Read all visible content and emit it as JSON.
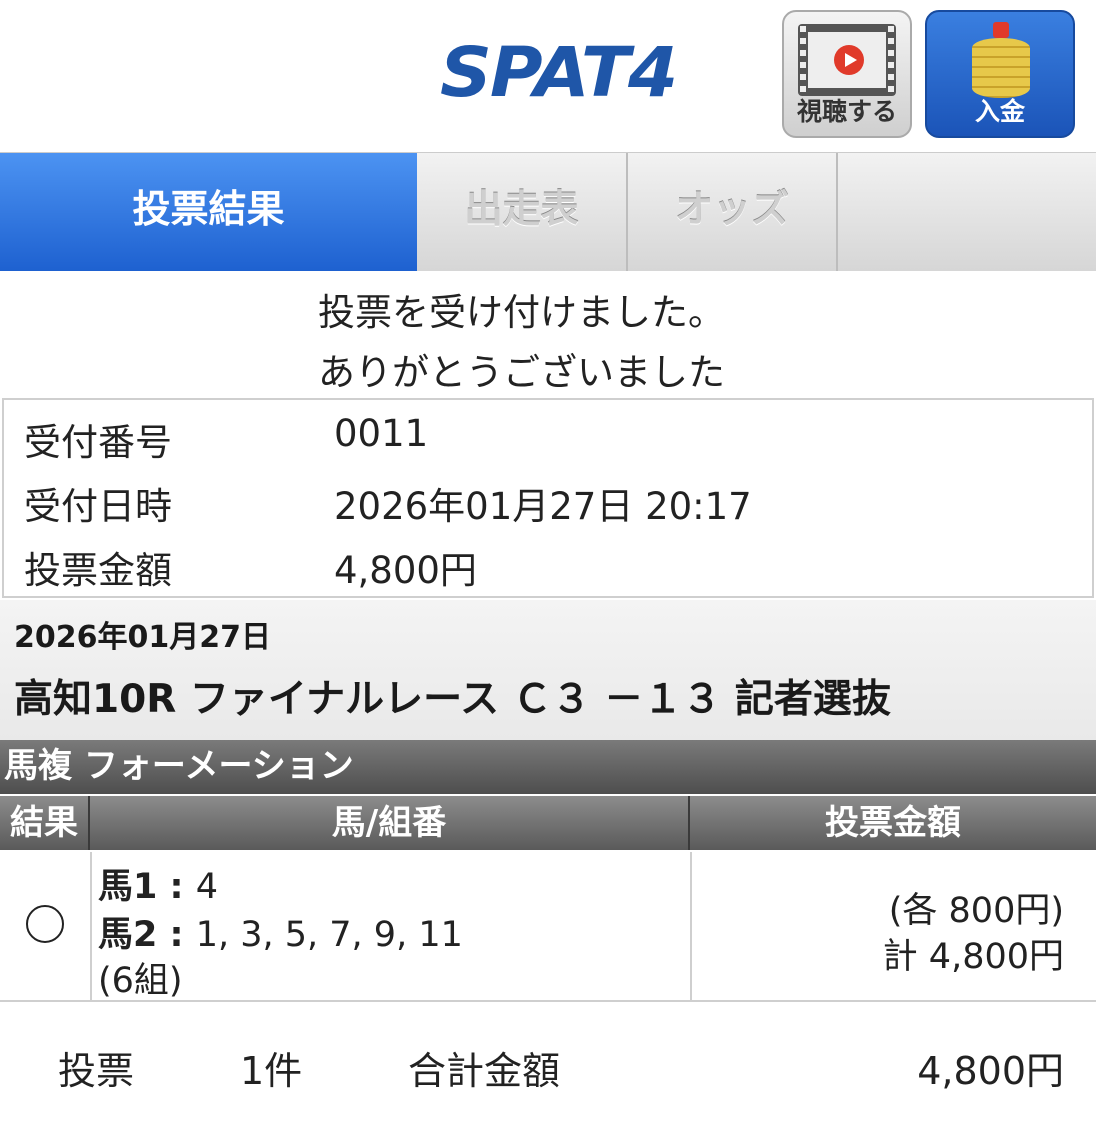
{
  "header": {
    "logo": "SPAT4",
    "watch_button": {
      "label": "視聴する",
      "icon": "video-play-icon"
    },
    "deposit_button": {
      "label": "入金",
      "icon": "coins-icon",
      "color": "#1f5cc4"
    }
  },
  "tabs": [
    {
      "label": "投票結果",
      "active": true
    },
    {
      "label": "出走表",
      "active": false
    },
    {
      "label": "オッズ",
      "active": false
    }
  ],
  "message": {
    "line1": "投票を受け付けました。",
    "line2": "ありがとうございました"
  },
  "receipt": {
    "rows": [
      {
        "label": "受付番号",
        "value": "0011"
      },
      {
        "label": "受付日時",
        "value": "2026年01月27日 20:17"
      },
      {
        "label": "投票金額",
        "value": "4,800円"
      }
    ]
  },
  "race": {
    "date": "2026年01月27日",
    "name": "高知10R ファイナルレース Ｃ３ －１３ 記者選抜"
  },
  "bet": {
    "type": "馬複 フォーメーション",
    "columns": [
      "結果",
      "馬/組番",
      "投票金額"
    ],
    "rows": [
      {
        "result": "",
        "horse1_label": "馬1",
        "horse1_value": "4",
        "horse2_label": "馬2",
        "horse2_value": "1, 3, 5, 7, 9, 11",
        "combos": "(6組)",
        "each": "(各 800円)",
        "total": "計 4,800円"
      }
    ]
  },
  "footer": {
    "count_label": "投票",
    "count_value": "1件",
    "total_label": "合計金額",
    "total_value": "4,800円"
  },
  "colors": {
    "tab_active": "#2a6fdc",
    "logo": "#1f56a8",
    "table_header": "#6a6a6a"
  }
}
